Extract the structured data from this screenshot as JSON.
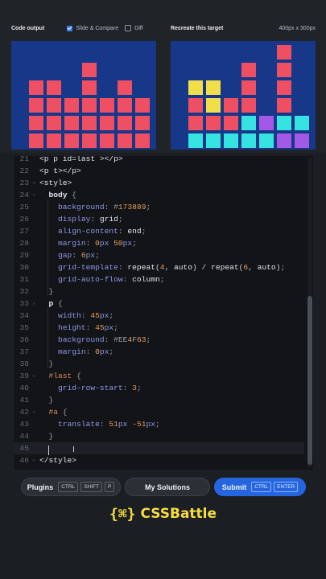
{
  "header": {
    "output_title": "Code output",
    "slide_compare_label": "Slide & Compare",
    "slide_compare_checked": true,
    "diff_label": "Diff",
    "diff_checked": false,
    "target_title": "Recreate this target",
    "target_size": "400px x 300px"
  },
  "colors": {
    "bg": "#173889",
    "red": "#EE4F63",
    "yellow": "#F0DF4B",
    "cyan": "#36E3E0",
    "purple": "#A259E6",
    "accent": "#2565E0",
    "brand": "#F6DC45"
  },
  "output_preview": {
    "columns": [
      {
        "blocks": 4
      },
      {
        "blocks": 4
      },
      {
        "blocks": 3
      },
      {
        "blocks": 5
      },
      {
        "blocks": 3
      },
      {
        "blocks": 4
      },
      {
        "blocks": 3
      }
    ]
  },
  "target_preview": {
    "columns": [
      [
        "cyan",
        "red",
        "red",
        "yellow"
      ],
      [
        "cyan",
        "red",
        "yellow",
        "yellow"
      ],
      [
        "cyan",
        "red",
        "red"
      ],
      [
        "cyan",
        "cyan",
        "red",
        "red",
        "red"
      ],
      [
        "cyan",
        "purple"
      ],
      [
        "purple",
        "cyan",
        "red",
        "red",
        "red",
        "red"
      ],
      [
        "purple",
        "cyan"
      ]
    ]
  },
  "editor": {
    "active_line": 45,
    "lines": [
      {
        "n": "21",
        "fold": "",
        "text": "<p p id=last ></p>"
      },
      {
        "n": "22",
        "fold": "",
        "text": "<p t></p>"
      },
      {
        "n": "23",
        "fold": "v",
        "text": "<style>"
      },
      {
        "n": "24",
        "fold": "v",
        "text": "  body {"
      },
      {
        "n": "25",
        "fold": "",
        "text": "    background: #173889;"
      },
      {
        "n": "26",
        "fold": "",
        "text": "    display: grid;"
      },
      {
        "n": "27",
        "fold": "",
        "text": "    align-content: end;"
      },
      {
        "n": "28",
        "fold": "",
        "text": "    margin: 0px 50px;"
      },
      {
        "n": "29",
        "fold": "",
        "text": "    gap: 6px;"
      },
      {
        "n": "30",
        "fold": "",
        "text": "    grid-template: repeat(4, auto) / repeat(6, auto);"
      },
      {
        "n": "31",
        "fold": "",
        "text": "    grid-auto-flow: column;"
      },
      {
        "n": "32",
        "fold": "",
        "text": "  }"
      },
      {
        "n": "33",
        "fold": "v",
        "text": "  p {"
      },
      {
        "n": "34",
        "fold": "",
        "text": "    width: 45px;"
      },
      {
        "n": "35",
        "fold": "",
        "text": "    height: 45px;"
      },
      {
        "n": "36",
        "fold": "",
        "text": "    background: #EE4F63;"
      },
      {
        "n": "37",
        "fold": "",
        "text": "    margin: 0px;"
      },
      {
        "n": "38",
        "fold": "",
        "text": "  }"
      },
      {
        "n": "39",
        "fold": "v",
        "text": "  #last {"
      },
      {
        "n": "40",
        "fold": "",
        "text": "    grid-row-start: 3;"
      },
      {
        "n": "41",
        "fold": "",
        "text": "  }"
      },
      {
        "n": "42",
        "fold": "v",
        "text": "  #a {"
      },
      {
        "n": "43",
        "fold": "",
        "text": "    translate: 51px -51px;"
      },
      {
        "n": "44",
        "fold": "",
        "text": "  }"
      },
      {
        "n": "45",
        "fold": "",
        "text": ""
      },
      {
        "n": "46",
        "fold": "v",
        "text": "</style>"
      }
    ]
  },
  "buttons": {
    "plugins_label": "Plugins",
    "plugins_keys": [
      "CTRL",
      "SHIFT",
      "P"
    ],
    "solutions_label": "My Solutions",
    "submit_label": "Submit",
    "submit_keys": [
      "CTRL",
      "ENTER"
    ]
  },
  "brand": {
    "logo": "{⌘}",
    "name": "CSSBattle"
  }
}
